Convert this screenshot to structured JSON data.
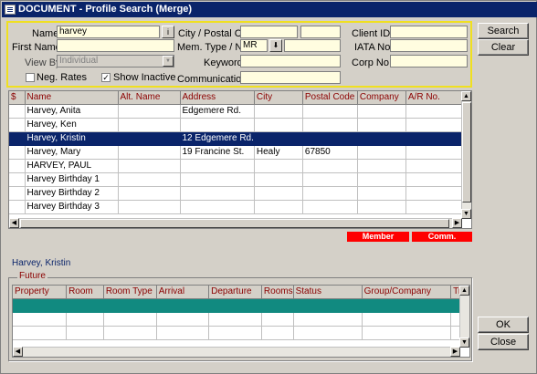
{
  "window": {
    "title": "DOCUMENT - Profile Search (Merge)"
  },
  "search": {
    "name_label": "Name",
    "name_value": "harvey",
    "info_button": "i",
    "first_name_label": "First Name",
    "first_name_value": "",
    "view_by_label": "View By",
    "view_by_value": "Individual",
    "neg_rates_label": "Neg. Rates",
    "neg_rates_checked": false,
    "show_inactive_label": "Show Inactive",
    "show_inactive_checked": true,
    "city_label": "City / Postal Cd.",
    "city_value": "",
    "postal_value": "",
    "mem_type_label": "Mem. Type / No.",
    "mem_type_value": "MR",
    "mem_no_value": "",
    "keyword_label": "Keyword",
    "keyword_value": "",
    "communication_label": "Communication",
    "communication_value": "",
    "client_id_label": "Client ID.",
    "client_id_value": "",
    "iata_label": "IATA No.",
    "iata_value": "",
    "corp_label": "Corp No.",
    "corp_value": ""
  },
  "buttons": {
    "search": "Search",
    "clear": "Clear",
    "ok": "OK",
    "close": "Close"
  },
  "results": {
    "columns": [
      "$",
      "Name",
      "Alt. Name",
      "Address",
      "City",
      "Postal Code",
      "Company",
      "A/R No."
    ],
    "rows": [
      {
        "flag": "",
        "name": "Harvey, Anita",
        "alt": "",
        "address": "Edgemere Rd.",
        "city": "",
        "postal": "",
        "company": "",
        "ar": ""
      },
      {
        "flag": "",
        "name": "Harvey, Ken",
        "alt": "",
        "address": "",
        "city": "",
        "postal": "",
        "company": "",
        "ar": ""
      },
      {
        "flag": "",
        "name": "Harvey, Kristin",
        "alt": "",
        "address": "12 Edgemere Rd.",
        "city": "",
        "postal": "",
        "company": "",
        "ar": ""
      },
      {
        "flag": "",
        "name": "Harvey, Mary",
        "alt": "",
        "address": "19 Francine St.",
        "city": "Healy",
        "postal": "67850",
        "company": "",
        "ar": ""
      },
      {
        "flag": "",
        "name": "HARVEY, PAUL",
        "alt": "",
        "address": "",
        "city": "",
        "postal": "",
        "company": "",
        "ar": ""
      },
      {
        "flag": "",
        "name": "Harvey Birthday 1",
        "alt": "",
        "address": "",
        "city": "",
        "postal": "",
        "company": "",
        "ar": ""
      },
      {
        "flag": "",
        "name": "Harvey Birthday 2",
        "alt": "",
        "address": "",
        "city": "",
        "postal": "",
        "company": "",
        "ar": ""
      },
      {
        "flag": "",
        "name": "Harvey Birthday 3",
        "alt": "",
        "address": "",
        "city": "",
        "postal": "",
        "company": "",
        "ar": ""
      }
    ],
    "selected_index": 2
  },
  "badges": {
    "member": "Member",
    "comm": "Comm."
  },
  "selected_profile": "Harvey, Kristin",
  "future": {
    "label": "Future",
    "columns": [
      "Property",
      "Room",
      "Room Type",
      "Arrival",
      "Departure",
      "Rooms",
      "Status",
      "Group/Company",
      "Tr"
    ]
  },
  "colors": {
    "accent": "#0a246a",
    "header_text": "#8b0000",
    "badge": "#ff0000",
    "highlight_border": "#f0e020",
    "future_selected": "#118a80"
  }
}
